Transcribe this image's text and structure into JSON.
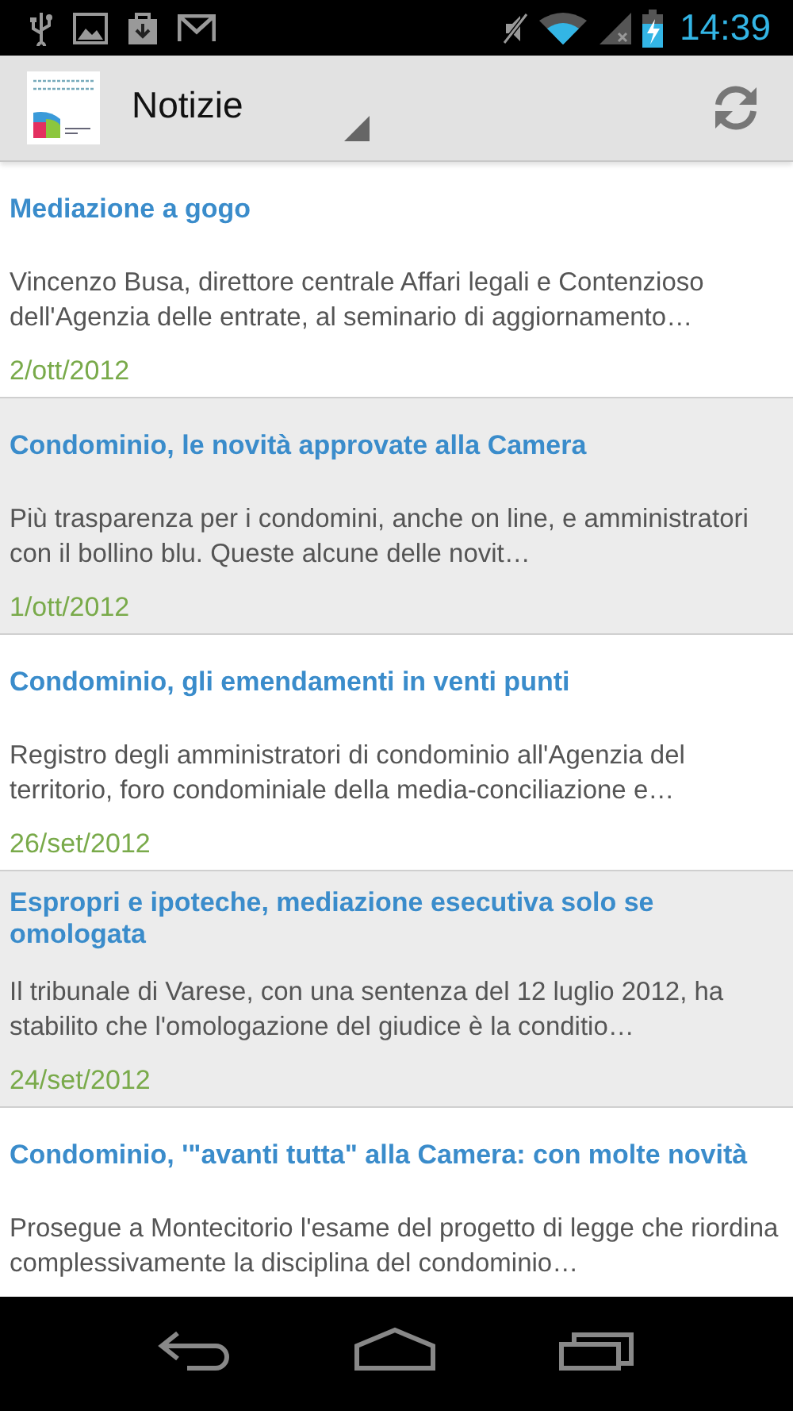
{
  "status_bar": {
    "time": "14:39"
  },
  "action_bar": {
    "title": "Notizie"
  },
  "news": [
    {
      "title": "Mediazione a gogo",
      "summary": "Vincenzo Busa, direttore centrale Affari legali e Contenzioso dell'Agenzia delle entrate, al seminario di aggiornamento…",
      "date": "2/ott/2012"
    },
    {
      "title": "Condominio, le novità approvate alla Camera",
      "summary": "Più trasparenza per i condomini, anche on line, e amministratori con il bollino blu. Queste alcune delle novit…",
      "date": "1/ott/2012"
    },
    {
      "title": "Condominio, gli emendamenti in venti punti",
      "summary": "Registro degli amministratori di condominio all'Agenzia del territorio, foro condominiale della media-conciliazione e…",
      "date": "26/set/2012"
    },
    {
      "title": "Espropri e ipoteche, mediazione esecutiva solo se omologata",
      "summary": "Il tribunale di Varese, con una sentenza del 12 luglio 2012, ha stabilito che l'omologazione del giudice è la conditio…",
      "date": "24/set/2012"
    },
    {
      "title": "Condominio, '\"avanti tutta\" alla Camera: con molte novità",
      "summary": "Prosegue a Montecitorio l'esame del progetto di legge che riordina complessivamente la disciplina del condominio…"
    }
  ]
}
